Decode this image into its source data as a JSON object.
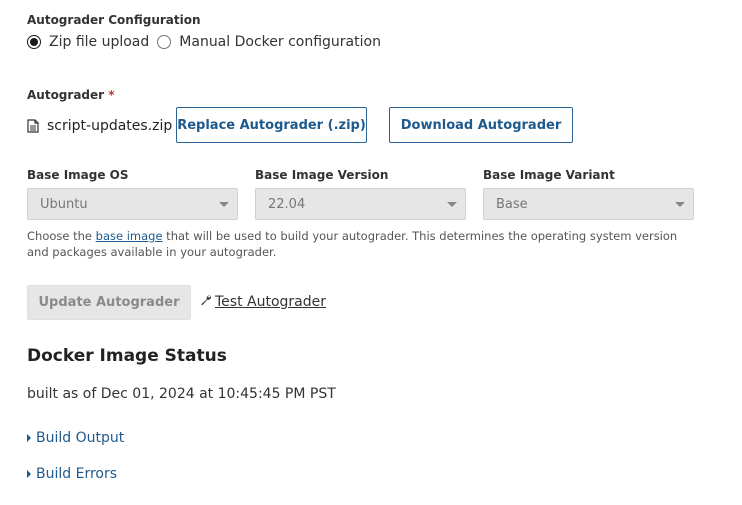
{
  "config": {
    "title": "Autograder Configuration",
    "options": [
      {
        "label": "Zip file upload",
        "checked": true
      },
      {
        "label": "Manual Docker configuration",
        "checked": false
      }
    ]
  },
  "autograder": {
    "label": "Autograder",
    "required_mark": "*",
    "filename": "script-updates.zip",
    "replace_button": "Replace Autograder (.zip)",
    "download_button": "Download Autograder"
  },
  "base_image": {
    "os": {
      "label": "Base Image OS",
      "value": "Ubuntu"
    },
    "version": {
      "label": "Base Image Version",
      "value": "22.04"
    },
    "variant": {
      "label": "Base Image Variant",
      "value": "Base"
    },
    "help_before": "Choose the ",
    "help_link": "base image",
    "help_after": " that will be used to build your autograder. This determines the operating system version and packages available in your autograder."
  },
  "actions": {
    "update_button": "Update Autograder",
    "test_link": "Test Autograder"
  },
  "docker_status": {
    "heading": "Docker Image Status",
    "status": "built as of Dec 01, 2024 at 10:45:45 PM PST",
    "build_output": "Build Output",
    "build_errors": "Build Errors"
  },
  "colors": {
    "link": "#1f5a8c",
    "required": "#c0392b",
    "disabled_bg": "#e6e6e6"
  },
  "icons": {
    "file": "file-text-icon",
    "wrench": "wrench-icon",
    "caret": "caret-right-icon"
  }
}
